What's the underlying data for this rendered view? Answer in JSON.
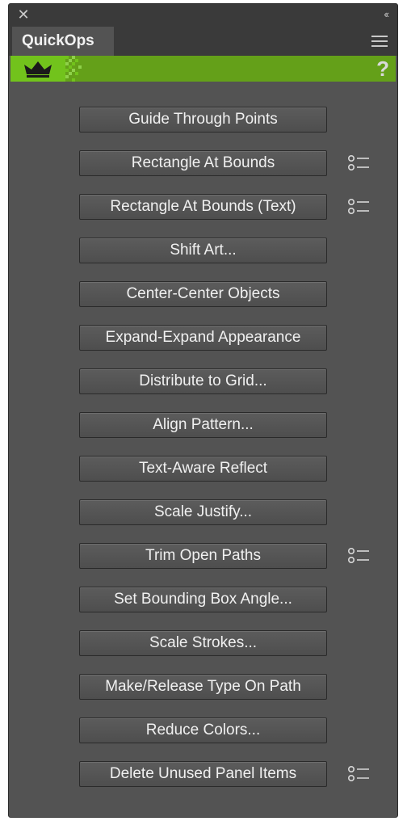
{
  "panel": {
    "tab_label": "QuickOps",
    "help_label": "?",
    "close_glyph": "✕",
    "collapse_glyph": "‹‹",
    "icons": [
      "close-icon",
      "collapse-icon",
      "menu-icon",
      "crown-icon",
      "help-icon",
      "options-list-icon"
    ],
    "colors": {
      "accent_green": "#64a019",
      "crown_green": "#72c31c",
      "panel_bg": "#535353"
    }
  },
  "buttons": [
    {
      "label": "Guide Through Points",
      "has_options": false
    },
    {
      "label": "Rectangle At Bounds",
      "has_options": true
    },
    {
      "label": "Rectangle At Bounds (Text)",
      "has_options": true
    },
    {
      "label": "Shift Art...",
      "has_options": false
    },
    {
      "label": "Center-Center Objects",
      "has_options": false
    },
    {
      "label": "Expand-Expand Appearance",
      "has_options": false
    },
    {
      "label": "Distribute to Grid...",
      "has_options": false
    },
    {
      "label": "Align Pattern...",
      "has_options": false
    },
    {
      "label": "Text-Aware Reflect",
      "has_options": false
    },
    {
      "label": "Scale Justify...",
      "has_options": false
    },
    {
      "label": "Trim Open Paths",
      "has_options": true
    },
    {
      "label": "Set Bounding Box Angle...",
      "has_options": false
    },
    {
      "label": "Scale Strokes...",
      "has_options": false
    },
    {
      "label": "Make/Release Type On Path",
      "has_options": false
    },
    {
      "label": "Reduce Colors...",
      "has_options": false
    },
    {
      "label": "Delete Unused Panel Items",
      "has_options": true
    }
  ]
}
